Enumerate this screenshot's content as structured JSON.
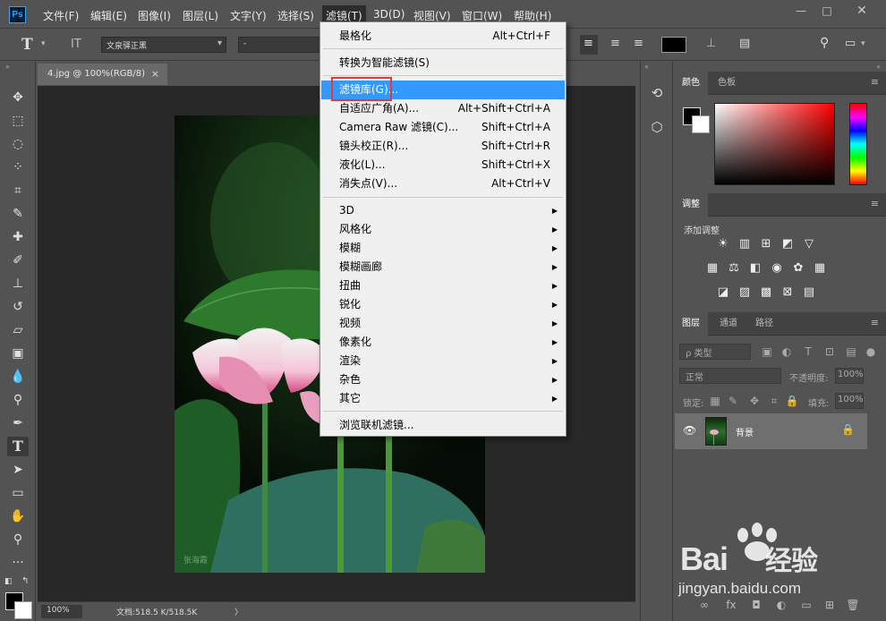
{
  "menubar": {
    "logo": "Ps",
    "items": [
      "文件(F)",
      "编辑(E)",
      "图像(I)",
      "图层(L)",
      "文字(Y)",
      "选择(S)",
      "滤镜(T)",
      "3D(D)",
      "视图(V)",
      "窗口(W)",
      "帮助(H)"
    ],
    "active_index": 6
  },
  "options_bar": {
    "text_tool_icon": "T",
    "orient_icon": "IT",
    "font_family": "文泉驿正黑",
    "font_style": "-"
  },
  "document": {
    "tab_label": "4.jpg @ 100%(RGB/8)",
    "close_glyph": "×",
    "photo_watermark": "张海霞"
  },
  "status": {
    "zoom": "100%",
    "doc_size": "文档:518.5 K/518.5K",
    "arrow": "〉"
  },
  "filter_menu": {
    "top_items": [
      {
        "label": "最格化",
        "shortcut": "Alt+Ctrl+F"
      },
      {
        "label": "转换为智能滤镜(S)",
        "shortcut": ""
      }
    ],
    "gallery_items": [
      {
        "label": "滤镜库(G)...",
        "shortcut": ""
      },
      {
        "label": "自适应广角(A)...",
        "shortcut": "Alt+Shift+Ctrl+A"
      },
      {
        "label": "Camera Raw 滤镜(C)...",
        "shortcut": "Shift+Ctrl+A"
      },
      {
        "label": "镜头校正(R)...",
        "shortcut": "Shift+Ctrl+R"
      },
      {
        "label": "液化(L)...",
        "shortcut": "Shift+Ctrl+X"
      },
      {
        "label": "消失点(V)...",
        "shortcut": "Alt+Ctrl+V"
      }
    ],
    "submenus": [
      "3D",
      "风格化",
      "模糊",
      "模糊画廊",
      "扭曲",
      "锐化",
      "视频",
      "像素化",
      "渲染",
      "杂色",
      "其它"
    ],
    "browse_label": "浏览联机滤镜...",
    "highlighted": "滤镜库(G)..."
  },
  "panels": {
    "color_tabs": [
      "颜色",
      "色板"
    ],
    "adjust_tab": "调整",
    "adjust_title": "添加调整",
    "layer_tabs": [
      "图层",
      "通道",
      "路径"
    ],
    "layer_search": "ρ 类型",
    "blend_mode": "正常",
    "opacity_label": "不透明度:",
    "opacity_value": "100%",
    "lock_label": "锁定:",
    "fill_label": "填充:",
    "fill_value": "100%",
    "layer_name": "背景"
  },
  "watermark": {
    "brand_a": "Bai",
    "brand_b": "经验",
    "url": "jingyan.baidu.com"
  },
  "colors": {
    "menu_highlight": "#3399ff",
    "annotation_box": "#e03a3a",
    "ui_bg": "#535353"
  }
}
